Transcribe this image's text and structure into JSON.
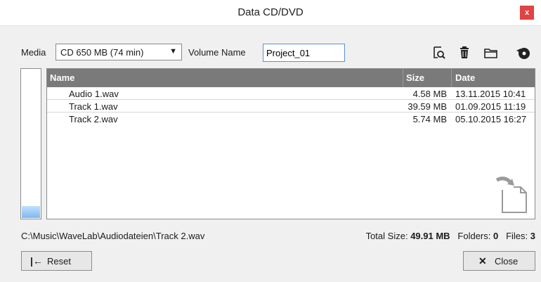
{
  "window": {
    "title": "Data CD/DVD",
    "close_glyph": "x"
  },
  "toolbar": {
    "media_label": "Media",
    "media_value": "CD 650 MB (74 min)",
    "volume_label": "Volume Name",
    "volume_value": "Project_01",
    "icons": [
      "search-file-icon",
      "trash-icon",
      "folder-icon",
      "burn-disc-icon"
    ]
  },
  "usage_meter": {
    "fill_fraction": 0.08
  },
  "file_list": {
    "columns": [
      "Name",
      "Size",
      "Date"
    ],
    "rows": [
      {
        "name": "Audio 1.wav",
        "size": "4.58 MB",
        "date": "13.11.2015 10:41"
      },
      {
        "name": "Track 1.wav",
        "size": "39.59 MB",
        "date": "01.09.2015 11:19"
      },
      {
        "name": "Track 2.wav",
        "size": "5.74 MB",
        "date": "05.10.2015 16:27"
      }
    ]
  },
  "status": {
    "path": "C:\\Music\\WaveLab\\Audiodateien\\Track 2.wav",
    "total_label": "Total Size:",
    "total_value": "49.91 MB",
    "folders_label": "Folders:",
    "folders_value": "0",
    "files_label": "Files:",
    "files_value": "3"
  },
  "buttons": {
    "reset_label": "Reset",
    "reset_glyph": "|←",
    "close_label": "Close",
    "close_glyph": "✕"
  },
  "colors": {
    "header_bg": "#7a7a7a",
    "close_red": "#e04343",
    "focus_blue": "#5c8fd6"
  }
}
